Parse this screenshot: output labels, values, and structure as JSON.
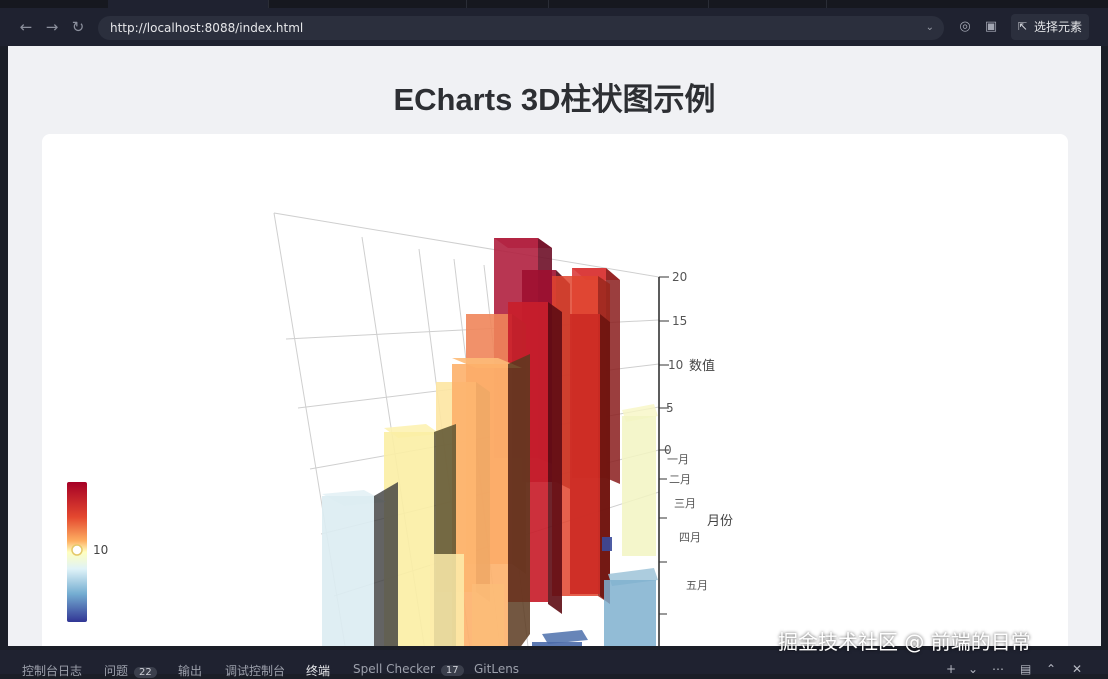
{
  "browser": {
    "url": "http://localhost:8088/index.html",
    "pick_element_label": "选择元素",
    "icons": [
      "back-arrow-icon",
      "forward-arrow-icon",
      "reload-icon",
      "chevron-down-icon",
      "tracking-icon",
      "device-emulation-icon",
      "cursor-pick-icon"
    ]
  },
  "page": {
    "title": "ECharts 3D柱状图示例"
  },
  "chart_data": {
    "type": "bar3D",
    "z_axis": {
      "name": "数值",
      "ticks": [
        "0",
        "5",
        "10",
        "15",
        "20"
      ],
      "range": [
        0,
        20
      ]
    },
    "y_axis": {
      "name": "月份",
      "visible_ticks": [
        "一月",
        "二月",
        "三月",
        "四月",
        "五月"
      ]
    },
    "visual_map": {
      "label": "10",
      "colors": [
        "#313695",
        "#74add1",
        "#e0f3f8",
        "#ffffbf",
        "#fdae61",
        "#f46d43",
        "#d73027",
        "#a50026"
      ]
    }
  },
  "panel": {
    "tabs": [
      {
        "label": "控制台日志"
      },
      {
        "label": "问题",
        "badge": "22"
      },
      {
        "label": "输出"
      },
      {
        "label": "调试控制台"
      },
      {
        "label": "终端"
      },
      {
        "label": "Spell Checker",
        "badge": "17"
      },
      {
        "label": "GitLens"
      }
    ],
    "icons": [
      "plus-icon",
      "chevron-down-icon",
      "ellipsis-icon",
      "layout-icon",
      "chevron-up-icon",
      "close-icon"
    ]
  },
  "watermark": "掘金技术社区 @ 前端的日常"
}
